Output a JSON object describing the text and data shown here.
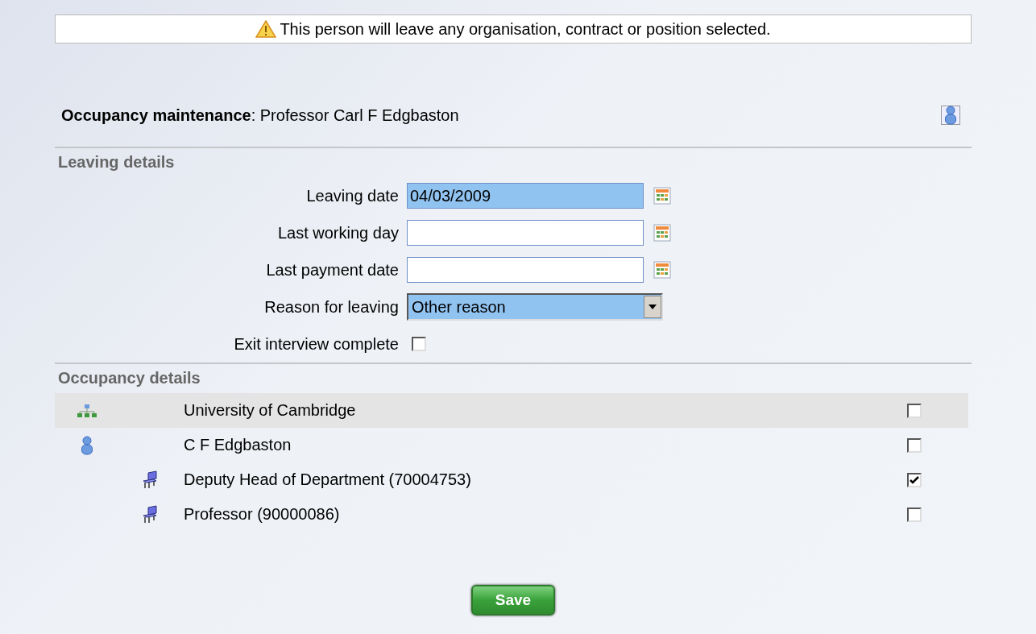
{
  "warning": {
    "text": "This person will leave any organisation, contract or position selected."
  },
  "header": {
    "label": "Occupancy maintenance",
    "separator": ":",
    "name": "Professor Carl F Edgbaston"
  },
  "leaving_details": {
    "title": "Leaving details",
    "fields": [
      {
        "kind": "date",
        "label": "Leaving date",
        "value": "04/03/2009",
        "highlighted": true
      },
      {
        "kind": "date",
        "label": "Last working day",
        "highlighted": false
      },
      {
        "kind": "date",
        "label": "Last payment date",
        "highlighted": false
      },
      {
        "kind": "select",
        "label": "Reason for leaving",
        "value": "Other reason",
        "highlighted": true
      },
      {
        "kind": "checkbox",
        "label": "Exit interview complete",
        "checked": false
      }
    ]
  },
  "occupancy_details": {
    "title": "Occupancy details",
    "items": [
      {
        "kind": "organisation",
        "label": "University of Cambridge",
        "checked": false,
        "selected": true
      },
      {
        "kind": "person",
        "label": "C F Edgbaston",
        "checked": false,
        "selected": false,
        "children": [
          {
            "kind": "position",
            "label": "Deputy Head of Department (70004753)",
            "checked": true,
            "selected": false
          },
          {
            "kind": "position",
            "label": "Professor (90000086)",
            "checked": false,
            "selected": false
          }
        ]
      }
    ]
  },
  "save_button": {
    "label": "Save"
  }
}
